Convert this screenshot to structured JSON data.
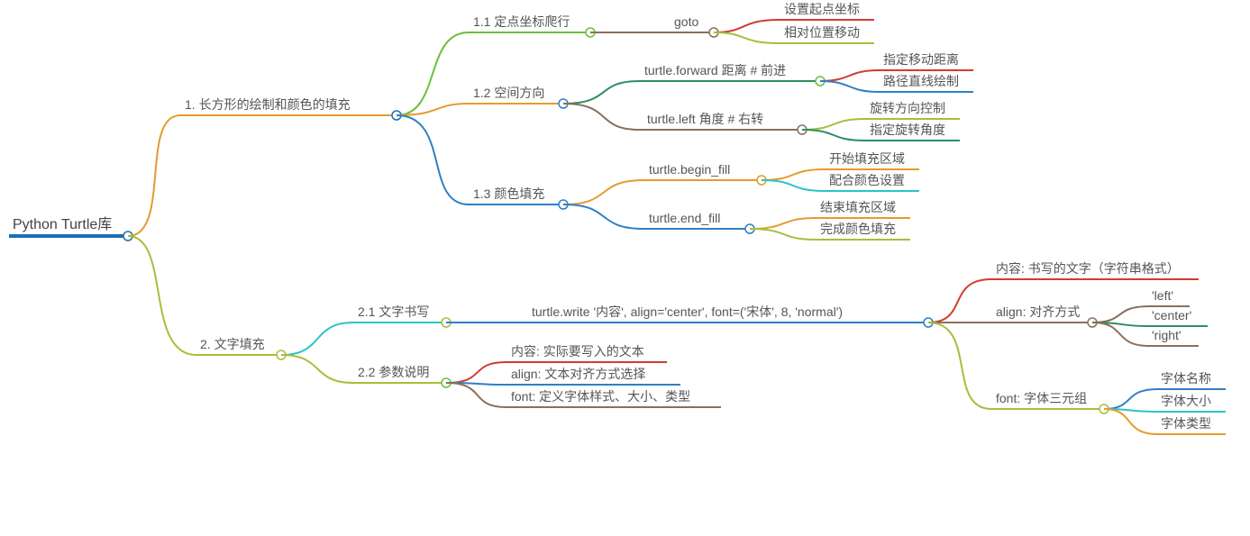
{
  "root": {
    "label": "Python Turtle库"
  },
  "n1": {
    "label": "1. 长方形的绘制和颜色的填充"
  },
  "n1_1": {
    "label": "1.1 定点坐标爬行"
  },
  "n1_1_goto": {
    "label": "goto"
  },
  "n1_1_leaf1": {
    "label": "设置起点坐标"
  },
  "n1_1_leaf2": {
    "label": "相对位置移动"
  },
  "n1_2": {
    "label": "1.2 空间方向"
  },
  "n1_2_fwd": {
    "label": "turtle.forward 距离 # 前进"
  },
  "n1_2_fwd_leaf1": {
    "label": "指定移动距离"
  },
  "n1_2_fwd_leaf2": {
    "label": "路径直线绘制"
  },
  "n1_2_left": {
    "label": "turtle.left 角度 # 右转"
  },
  "n1_2_left_leaf1": {
    "label": "旋转方向控制"
  },
  "n1_2_left_leaf2": {
    "label": "指定旋转角度"
  },
  "n1_3": {
    "label": "1.3 颜色填充"
  },
  "n1_3_begin": {
    "label": "turtle.begin_fill"
  },
  "n1_3_begin_leaf1": {
    "label": "开始填充区域"
  },
  "n1_3_begin_leaf2": {
    "label": "配合颜色设置"
  },
  "n1_3_end": {
    "label": "turtle.end_fill"
  },
  "n1_3_end_leaf1": {
    "label": "结束填充区域"
  },
  "n1_3_end_leaf2": {
    "label": "完成颜色填充"
  },
  "n2": {
    "label": "2. 文字填充"
  },
  "n2_1": {
    "label": "2.1 文字书写"
  },
  "n2_1_write": {
    "label": "turtle.write '内容', align='center', font=('宋体', 8, 'normal')"
  },
  "n2_1_content": {
    "label": "内容: 书写的文字（字符串格式）"
  },
  "n2_1_align": {
    "label": "align: 对齐方式"
  },
  "n2_1_align_l": {
    "label": "'left'"
  },
  "n2_1_align_c": {
    "label": "'center'"
  },
  "n2_1_align_r": {
    "label": "'right'"
  },
  "n2_1_font": {
    "label": "font: 字体三元组"
  },
  "n2_1_font_n": {
    "label": "字体名称"
  },
  "n2_1_font_s": {
    "label": "字体大小"
  },
  "n2_1_font_t": {
    "label": "字体类型"
  },
  "n2_2": {
    "label": "2.2 参数说明"
  },
  "n2_2_c": {
    "label": "内容: 实际要写入的文本"
  },
  "n2_2_a": {
    "label": "align: 文本对齐方式选择"
  },
  "n2_2_f": {
    "label": "font: 定义字体样式、大小、类型"
  },
  "chart_data": {
    "type": "mindmap",
    "root": "Python Turtle库",
    "children": [
      {
        "label": "1. 长方形的绘制和颜色的填充",
        "children": [
          {
            "label": "1.1 定点坐标爬行",
            "children": [
              {
                "label": "goto",
                "children": [
                  {
                    "label": "设置起点坐标"
                  },
                  {
                    "label": "相对位置移动"
                  }
                ]
              }
            ]
          },
          {
            "label": "1.2 空间方向",
            "children": [
              {
                "label": "turtle.forward 距离 # 前进",
                "children": [
                  {
                    "label": "指定移动距离"
                  },
                  {
                    "label": "路径直线绘制"
                  }
                ]
              },
              {
                "label": "turtle.left 角度 # 右转",
                "children": [
                  {
                    "label": "旋转方向控制"
                  },
                  {
                    "label": "指定旋转角度"
                  }
                ]
              }
            ]
          },
          {
            "label": "1.3 颜色填充",
            "children": [
              {
                "label": "turtle.begin_fill",
                "children": [
                  {
                    "label": "开始填充区域"
                  },
                  {
                    "label": "配合颜色设置"
                  }
                ]
              },
              {
                "label": "turtle.end_fill",
                "children": [
                  {
                    "label": "结束填充区域"
                  },
                  {
                    "label": "完成颜色填充"
                  }
                ]
              }
            ]
          }
        ]
      },
      {
        "label": "2. 文字填充",
        "children": [
          {
            "label": "2.1 文字书写",
            "children": [
              {
                "label": "turtle.write '内容', align='center', font=('宋体', 8, 'normal')",
                "children": [
                  {
                    "label": "内容: 书写的文字（字符串格式）"
                  },
                  {
                    "label": "align: 对齐方式",
                    "children": [
                      {
                        "label": "'left'"
                      },
                      {
                        "label": "'center'"
                      },
                      {
                        "label": "'right'"
                      }
                    ]
                  },
                  {
                    "label": "font: 字体三元组",
                    "children": [
                      {
                        "label": "字体名称"
                      },
                      {
                        "label": "字体大小"
                      },
                      {
                        "label": "字体类型"
                      }
                    ]
                  }
                ]
              }
            ]
          },
          {
            "label": "2.2 参数说明",
            "children": [
              {
                "label": "内容: 实际要写入的文本"
              },
              {
                "label": "align: 文本对齐方式选择"
              },
              {
                "label": "font: 定义字体样式、大小、类型"
              }
            ]
          }
        ]
      }
    ]
  }
}
